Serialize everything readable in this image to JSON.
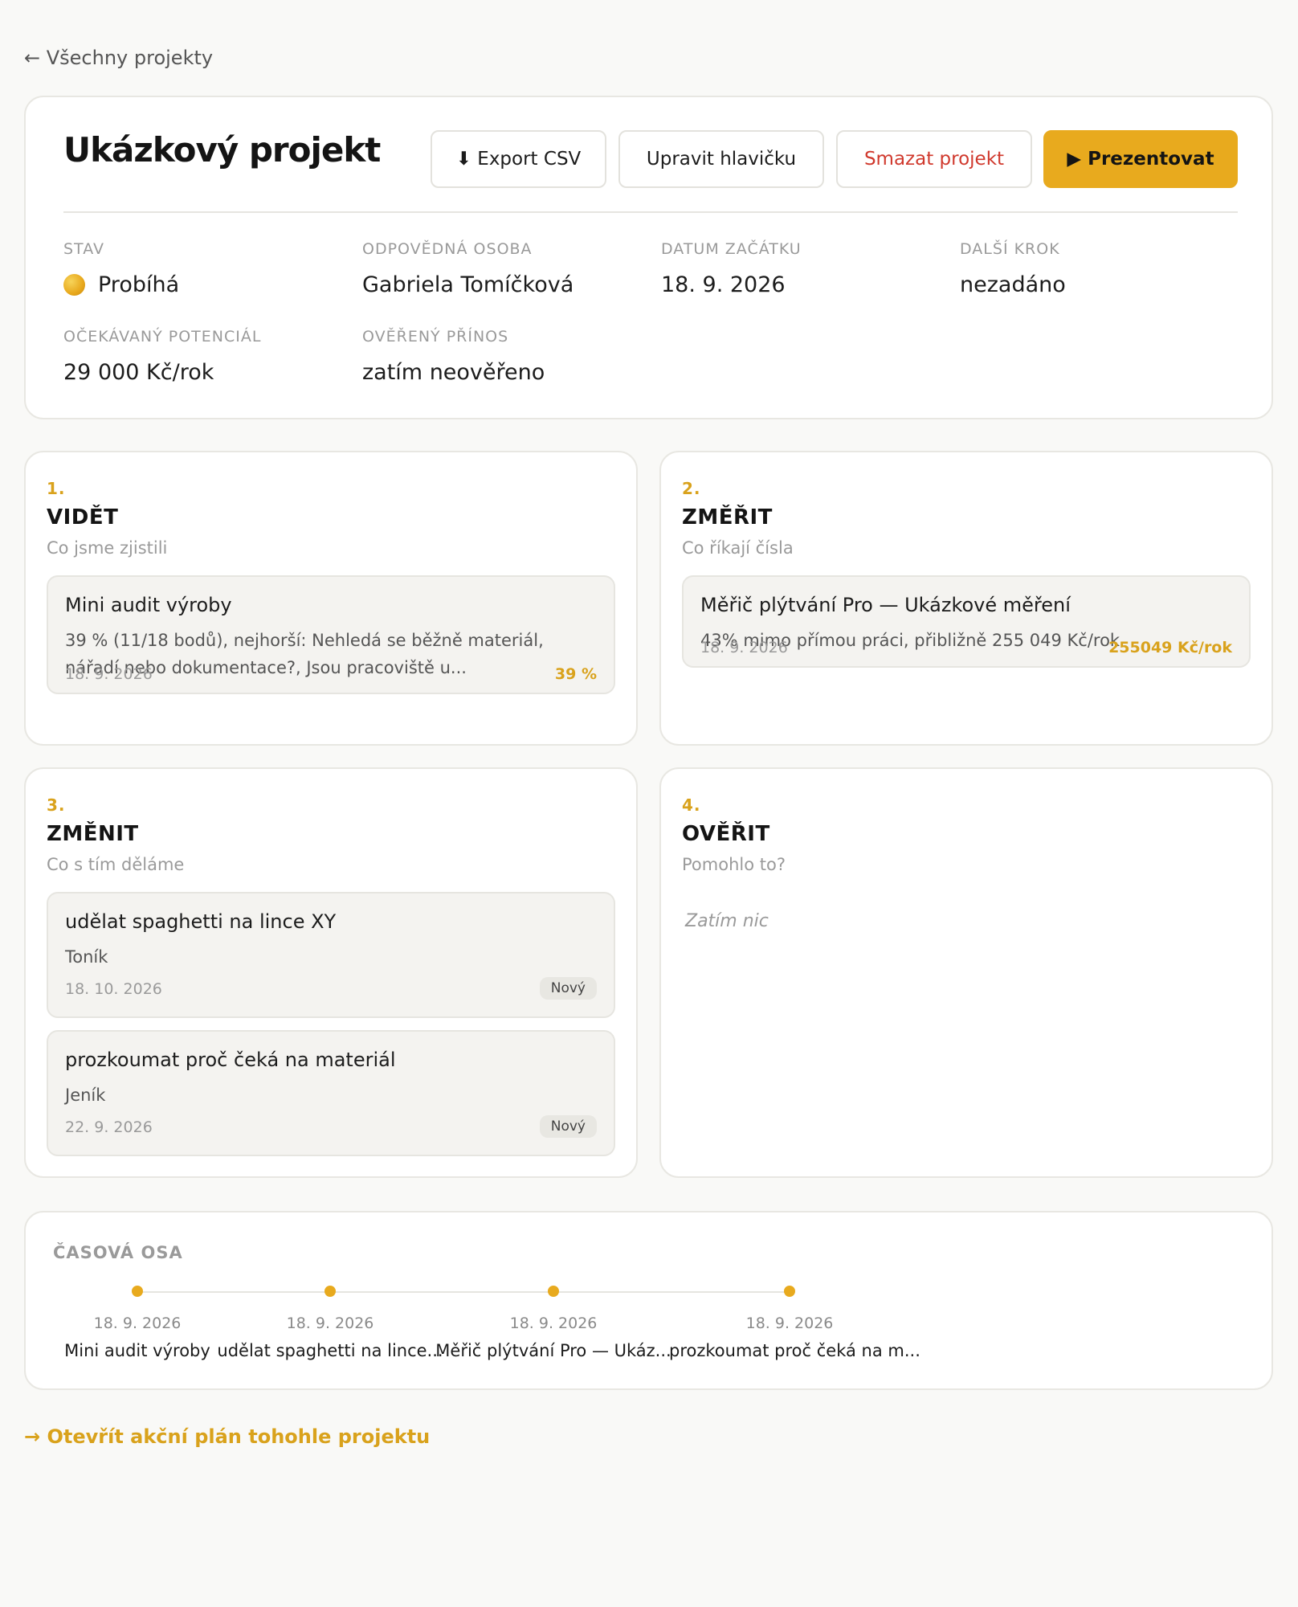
{
  "nav": {
    "back_label": "← Všechny projekty"
  },
  "header": {
    "title": "Ukázkový projekt",
    "buttons": {
      "export": "⬇ Export CSV",
      "edit": "Upravit hlavičku",
      "delete": "Smazat projekt",
      "present": "▶ Prezentovat"
    },
    "meta": {
      "status": {
        "label": "STAV",
        "value": "Probíhá"
      },
      "owner": {
        "label": "ODPOVĚDNÁ OSOBA",
        "value": "Gabriela Tomíčková"
      },
      "start": {
        "label": "DATUM ZAČÁTKU",
        "value": "18. 9. 2026"
      },
      "next": {
        "label": "DALŠÍ KROK",
        "value": "nezadáno"
      },
      "potential": {
        "label": "OČEKÁVANÝ POTENCIÁL",
        "value": "29 000 Kč/rok"
      },
      "benefit": {
        "label": "OVĚŘENÝ PŘÍNOS",
        "value": "zatím neověřeno"
      }
    }
  },
  "phases": [
    {
      "number": "1.",
      "title": "VIDĚT",
      "subtitle": "Co jsme zjistili",
      "items": [
        {
          "title": "Mini audit výroby",
          "description": "39 % (11/18 bodů), nejhorší: Nehledá se běžně materiál, nářadí nebo dokumentace?, Jsou pracoviště u...",
          "date": "18. 9. 2026",
          "metric": "39 %"
        }
      ]
    },
    {
      "number": "2.",
      "title": "ZMĚŘIT",
      "subtitle": "Co říkají čísla",
      "items": [
        {
          "title": "Měřič plýtvání Pro — Ukázkové měření",
          "description": "43% mimo přímou práci, přibližně 255 049 Kč/rok",
          "date": "18. 9. 2026",
          "metric": "255049 Kč/rok"
        }
      ]
    },
    {
      "number": "3.",
      "title": "ZMĚNIT",
      "subtitle": "Co s tím děláme",
      "items": [
        {
          "title": "udělat spaghetti na lince XY",
          "owner": "Toník",
          "date": "18. 10. 2026",
          "badge": "Nový"
        },
        {
          "title": "prozkoumat proč čeká na materiál",
          "owner": "Jeník",
          "date": "22. 9. 2026",
          "badge": "Nový"
        }
      ]
    },
    {
      "number": "4.",
      "title": "OVĚŘIT",
      "subtitle": "Pomohlo to?",
      "empty": "Zatím nic"
    }
  ],
  "timeline": {
    "title": "ČASOVÁ OSA",
    "events": [
      {
        "date": "18. 9. 2026",
        "label": "Mini audit výroby"
      },
      {
        "date": "18. 9. 2026",
        "label": "udělat spaghetti na lince..."
      },
      {
        "date": "18. 9. 2026",
        "label": "Měřič plýtvání Pro — Ukáz..."
      },
      {
        "date": "18. 9. 2026",
        "label": "prozkoumat proč čeká na m..."
      }
    ]
  },
  "footer": {
    "action_link": "→ Otevřít akční plán tohohle projektu"
  },
  "colors": {
    "accent": "#e8aa1e",
    "accent_text": "#d9a21c",
    "danger": "#d0392d"
  }
}
